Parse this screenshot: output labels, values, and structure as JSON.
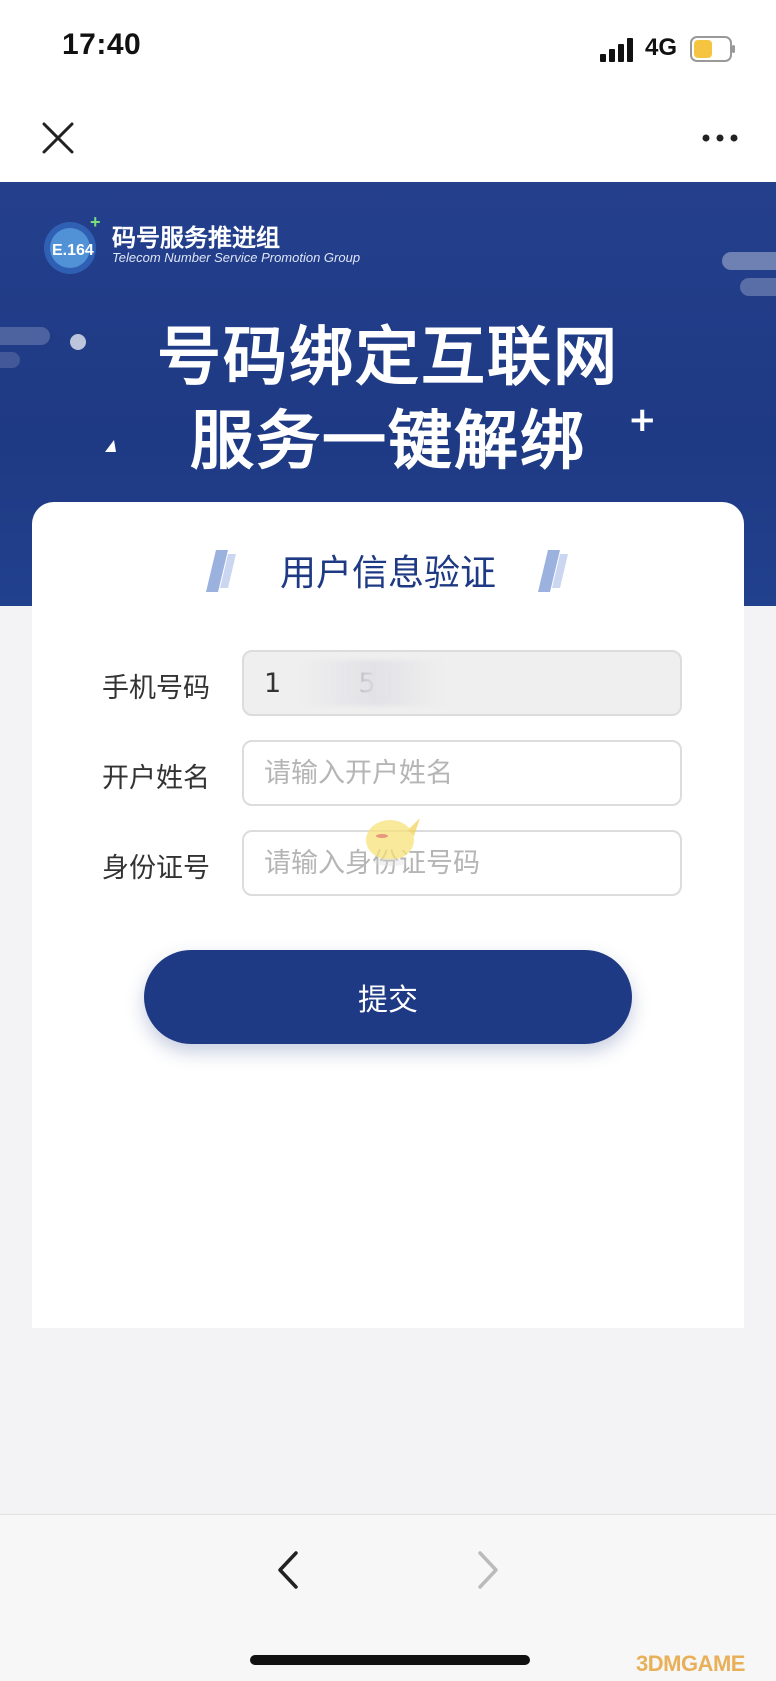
{
  "status_bar": {
    "time": "17:40",
    "network": "4G",
    "icons": [
      "signal-icon",
      "battery-icon"
    ],
    "battery_color": "#f5c542"
  },
  "nav": {
    "icons": [
      "close-icon",
      "more-icon"
    ]
  },
  "banner": {
    "logo_text": "E.164",
    "org_name_cn": "码号服务推进组",
    "org_name_en": "Telecom Number Service  Promotion Group",
    "headline_line1": "号码绑定互联网",
    "headline_line2": "服务一键解绑",
    "headline_plus": "+",
    "background_color": "#1f3a84"
  },
  "form": {
    "title": "用户信息验证",
    "phone": {
      "label": "手机号码",
      "value": "1         5"
    },
    "name": {
      "label": "开户姓名",
      "placeholder": "请输入开户姓名"
    },
    "id_number": {
      "label": "身份证号",
      "placeholder": "请输入身份证号码"
    },
    "submit_label": "提交",
    "accent_color": "#1f3a84"
  },
  "bottom_bar": {
    "icons": [
      "back-icon",
      "forward-icon"
    ],
    "watermark": "3DMGAME"
  }
}
